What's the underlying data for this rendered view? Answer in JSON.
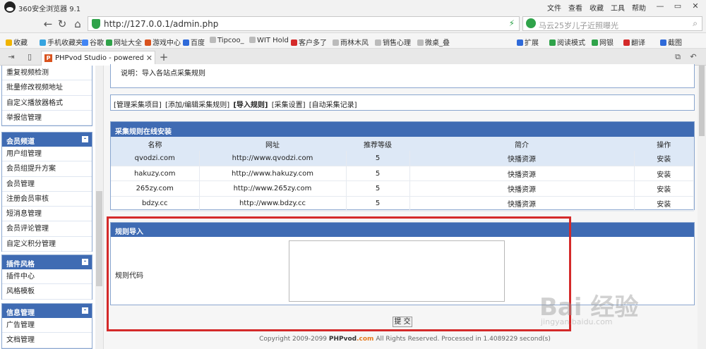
{
  "browser": {
    "title": "360安全浏览器 9.1",
    "menus": [
      "文件",
      "查看",
      "收藏",
      "工具",
      "帮助"
    ],
    "url": "http://127.0.0.1/admin.php",
    "search_placeholder": "马云25岁儿子近照曝光",
    "bookmarks": [
      "收藏",
      "手机收藏夹",
      "谷歌",
      "网址大全",
      "游戏中心",
      "百度",
      "Tipcoo_",
      "WIT Hold",
      "客户多了",
      "雨林木风",
      "销售心理",
      "微桌_叠"
    ],
    "extensions": [
      "扩展",
      "阅读模式",
      "网银",
      "翻译",
      "截图"
    ],
    "tab_title": "PHPvod Studio - powered by"
  },
  "sidebar": {
    "items_top": [
      "重复视频检测",
      "批量修改视频地址",
      "自定义播放器格式",
      "举报信管理"
    ],
    "panels": [
      {
        "title": "会员频道",
        "toggle": "-",
        "items": [
          "用户组管理",
          "会员组提升方案",
          "会员管理",
          "注册会员审核",
          "短消息管理",
          "会员评论管理",
          "自定义积分管理"
        ]
      },
      {
        "title": "插件风格",
        "toggle": "-",
        "items": [
          "插件中心",
          "风格模板"
        ]
      },
      {
        "title": "信息管理",
        "toggle": "-",
        "items": [
          "广告管理",
          "文档管理"
        ]
      }
    ]
  },
  "main": {
    "info": "说明：导入各站点采集规则",
    "tabnav": [
      "[管理采集项目]",
      "[添加/编辑采集规则]",
      "[导入规则]",
      "[采集设置]",
      "[自动采集记录]"
    ],
    "rules_title": "采集规则在线安装",
    "columns": [
      "名称",
      "网址",
      "推荐等级",
      "简介",
      "操作"
    ],
    "rows": [
      [
        "qvodzi.com",
        "http://www.qvodzi.com",
        "5",
        "快播资源",
        "安装"
      ],
      [
        "hakuzy.com",
        "http://www.hakuzy.com",
        "5",
        "快播资源",
        "安装"
      ],
      [
        "265zy.com",
        "http://www.265zy.com",
        "5",
        "快播资源",
        "安装"
      ],
      [
        "bdzy.cc",
        "http://www.bdzy.cc",
        "5",
        "快播资源",
        "安装"
      ]
    ],
    "import_title": "规则导入",
    "code_label": "规则代码",
    "code_value": "",
    "submit": "提 交",
    "footer_pre": "Copyright 2009-2099",
    "footer_brand": "PHPvod",
    "footer_brand_suffix": ".com",
    "footer_post": "All Rights Reserved. Processed in 1.4089229 second(s)"
  },
  "watermark": {
    "logo": "Bai 经验",
    "sub": "jingyan.baidu.com"
  },
  "colors": {
    "header_blue": "#3f6bb3",
    "highlight_red": "#d42a2a",
    "row_blue": "#dde8f6"
  }
}
